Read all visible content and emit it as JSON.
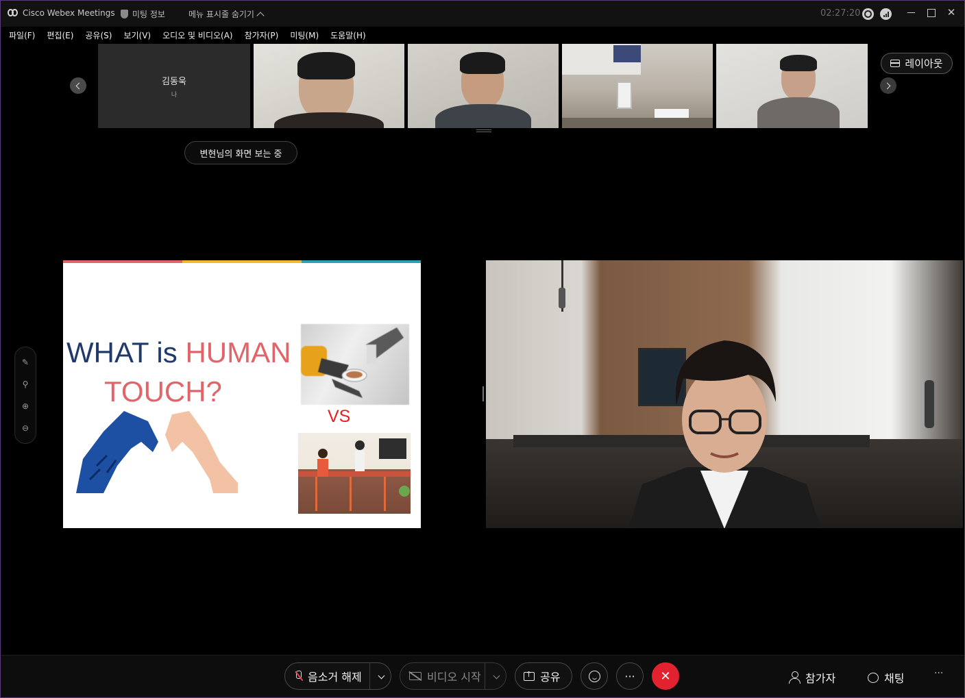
{
  "titlebar": {
    "app_name": "Cisco Webex Meetings",
    "meeting_info": "미팅 정보",
    "hide_menu": "메뉴 표시줄 숨기기",
    "clock": "02:27:20"
  },
  "menu": [
    "파일(F)",
    "편집(E)",
    "공유(S)",
    "보기(V)",
    "오디오 및 비디오(A)",
    "참가자(P)",
    "미팅(M)",
    "도움말(H)"
  ],
  "strip": {
    "self_name": "김동욱",
    "self_label": "나",
    "layout_label": "레이아웃"
  },
  "viewing_label": "변현님의 화면 보는 중",
  "slide": {
    "title_word1": "WHAT is ",
    "title_word2": "HUMAN",
    "title_line2": "TOUCH?",
    "vs": "VS",
    "bar_colors": [
      "#e06468",
      "#f0b732",
      "#2aa2b4"
    ],
    "title_color_dark": "#1f3a6a",
    "title_color_accent": "#e06468"
  },
  "controls": {
    "unmute": "음소거 해제",
    "start_video": "비디오 시작",
    "share": "공유",
    "more": "···",
    "participants": "참가자",
    "chat": "채팅",
    "overflow": "···"
  },
  "colors": {
    "leave_button": "#e2222e",
    "window_border": "#5a3d78"
  }
}
